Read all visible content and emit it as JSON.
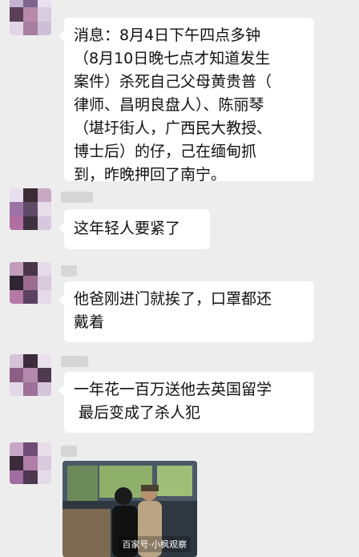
{
  "messages": [
    {
      "text": "消息：8月4日下午四点多钟（8月10日晚七点才知道发生案件）杀死自己父母黄贵普（律师、昌明良盘人）、陈丽琴（堪圩街人，广西民大教授、博士后）的仔，己在缅甸抓到，昨晚押回了南宁。",
      "lines": [
        "消息：8月4日下午四点多钟",
        "（8月10日晚七点才知道发生",
        "案件）杀死自己父母黄贵普（",
        "律师、昌明良盘人）、陈丽琴",
        "（堪圩街人，广西民大教授、",
        "博士后）的仔，己在缅甸抓",
        "到，昨晚押回了南宁。"
      ]
    },
    {
      "text": "这年轻人要紧了"
    },
    {
      "text": "他爸刚进门就挨了，口罩都还戴着",
      "lines": [
        "他爸刚进门就挨了，口罩都还",
        "戴着"
      ]
    },
    {
      "text": "一年花一百万送他去英国留学 最后变成了杀人犯",
      "lines": [
        "一年花一百万送他去英国留学",
        " 最后变成了杀人犯"
      ]
    }
  ],
  "photo": {
    "description_icon": "chat-photo",
    "watermark": "百家号·小枫观察"
  },
  "colors": {
    "background": "#ededed",
    "bubble": "#ffffff",
    "text": "#111111"
  }
}
